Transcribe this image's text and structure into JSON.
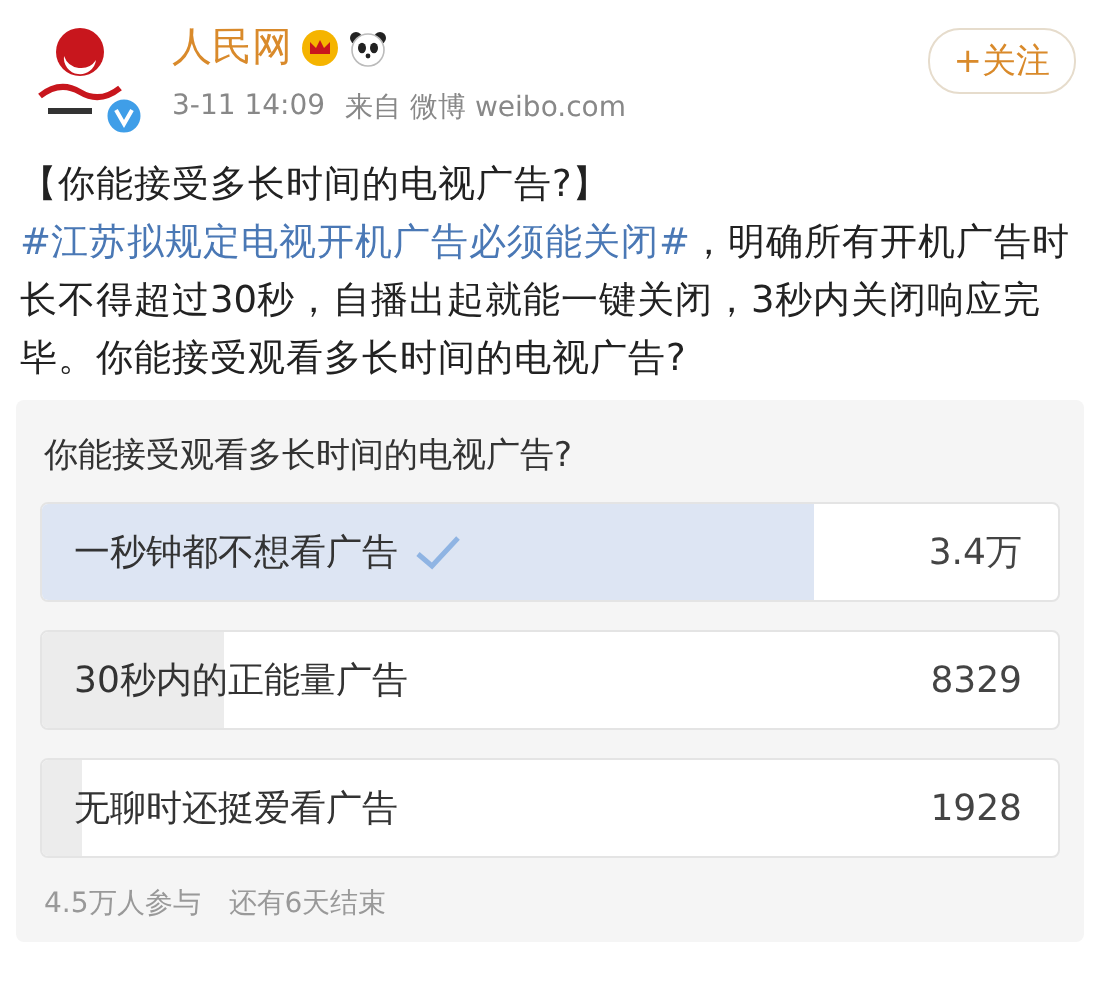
{
  "author": {
    "name": "人民网",
    "verified": true,
    "time": "3-11 14:09",
    "source": "来自 微博 weibo.com"
  },
  "follow_button": {
    "label": "+关注"
  },
  "post": {
    "prefix": "【你能接受多长时间的电视广告?】",
    "hashtag": "#江苏拟规定电视开机广告必须能关闭#",
    "body": "，明确所有开机广告时长不得超过30秒，自播出起就能一键关闭，3秒内关闭响应完毕。你能接受观看多长时间的电视广告?"
  },
  "poll": {
    "question": "你能接受观看多长时间的电视广告?",
    "options": [
      {
        "label": "一秒钟都不想看广告",
        "count": "3.4万",
        "level": 0.76,
        "selected": true
      },
      {
        "label": "30秒内的正能量广告",
        "count": "8329",
        "level": 0.18,
        "selected": false
      },
      {
        "label": "无聊时还挺爱看广告",
        "count": "1928",
        "level": 0.04,
        "selected": false
      }
    ],
    "participants": "4.5万人参与",
    "remaining": "还有6天结束"
  }
}
